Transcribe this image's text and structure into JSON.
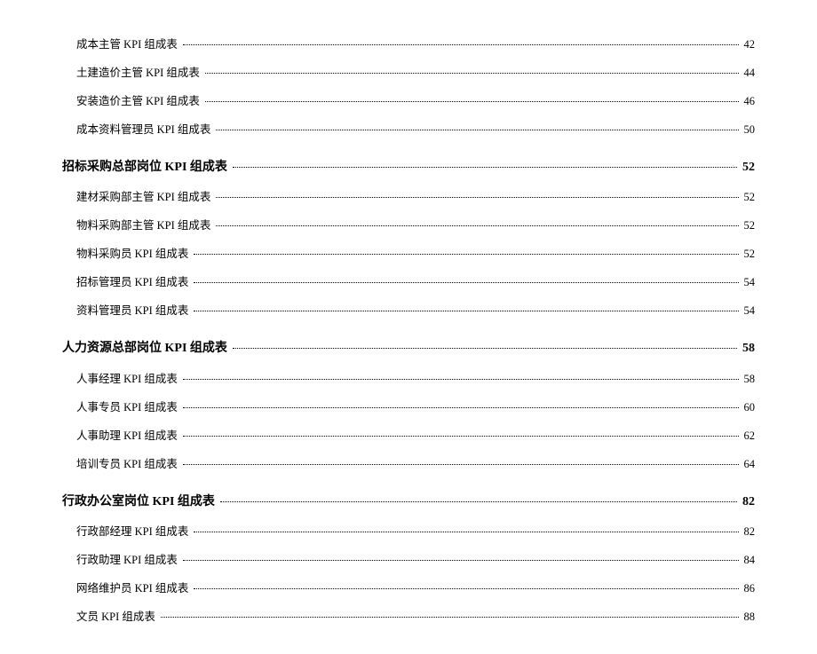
{
  "toc": [
    {
      "type": "item",
      "label": "成本主管 KPI 组成表",
      "page": "42"
    },
    {
      "type": "item",
      "label": "土建造价主管 KPI 组成表",
      "page": "44"
    },
    {
      "type": "item",
      "label": "安装造价主管 KPI 组成表",
      "page": "46"
    },
    {
      "type": "item",
      "label": "成本资料管理员 KPI 组成表",
      "page": "50"
    },
    {
      "type": "section",
      "label": "招标采购总部岗位 KPI 组成表",
      "page": "52"
    },
    {
      "type": "item",
      "label": "建材采购部主管 KPI 组成表",
      "page": "52"
    },
    {
      "type": "item",
      "label": "物料采购部主管 KPI 组成表",
      "page": "52"
    },
    {
      "type": "item",
      "label": "物料采购员 KPI 组成表",
      "page": "52"
    },
    {
      "type": "item",
      "label": "招标管理员 KPI 组成表",
      "page": "54"
    },
    {
      "type": "item",
      "label": "资料管理员 KPI 组成表",
      "page": "54"
    },
    {
      "type": "section",
      "label": "人力资源总部岗位 KPI 组成表",
      "page": "58"
    },
    {
      "type": "item",
      "label": "人事经理 KPI 组成表",
      "page": "58"
    },
    {
      "type": "item",
      "label": "人事专员 KPI 组成表",
      "page": "60"
    },
    {
      "type": "item",
      "label": "人事助理 KPI 组成表",
      "page": "62"
    },
    {
      "type": "item",
      "label": "培训专员 KPI 组成表",
      "page": "64"
    },
    {
      "type": "section",
      "label": "行政办公室岗位 KPI 组成表",
      "page": "82"
    },
    {
      "type": "item",
      "label": "行政部经理 KPI 组成表",
      "page": "82"
    },
    {
      "type": "item",
      "label": "行政助理 KPI 组成表",
      "page": "84"
    },
    {
      "type": "item",
      "label": "网络维护员 KPI 组成表",
      "page": "86"
    },
    {
      "type": "item",
      "label": "文员 KPI 组成表",
      "page": "88"
    }
  ]
}
